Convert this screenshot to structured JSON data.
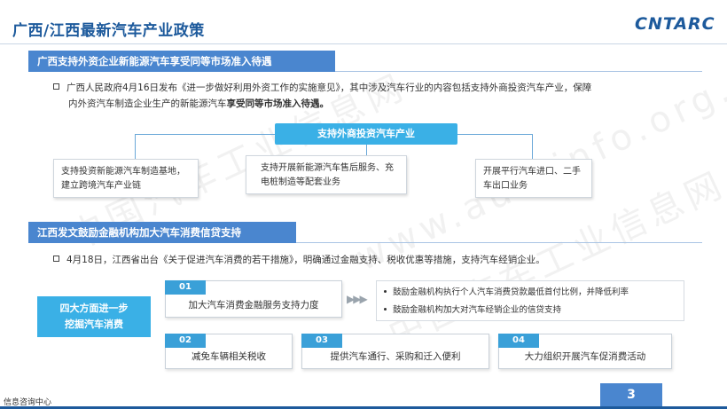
{
  "header": {
    "title": "广西/江西最新汽车产业政策",
    "logo": "CNTARC"
  },
  "section1": {
    "title": "广西支持外资企业新能源汽车享受同等市场准入待遇",
    "bullet_line1": "广西人民政府4月16日发布《进一步做好利用外资工作的实施意见》，其中涉及汽车行业的内容包括支持外商投资汽车产业，保障",
    "bullet_line2_plain": "内外资汽车制造企业生产的新能源汽车",
    "bullet_line2_bold": "享受同等市场准入待遇。",
    "hub": "支持外商投资汽车产业",
    "cards": [
      "支持投资新能源汽车制造基地，建立跨境汽车产业链",
      "支持开展新能源汽车售后服务、充电桩制造等配套业务",
      "开展平行汽车进口、二手车出口业务"
    ]
  },
  "section2": {
    "title": "江西发文鼓励金融机构加大汽车消费信贷支持",
    "bullet": "4月18日，江西省出台《关于促进汽车消费的若干措施》，明确通过金融支持、税收优惠等措施，支持汽车经销企业。",
    "main_box_line1": "四大方面进一步",
    "main_box_line2": "挖掘汽车消费",
    "items": [
      {
        "num": "01",
        "text": "加大汽车消费金融服务支持力度"
      },
      {
        "num": "02",
        "text": "减免车辆相关税收"
      },
      {
        "num": "03",
        "text": "提供汽车通行、采购和迁入便利"
      },
      {
        "num": "04",
        "text": "大力组织开展汽车促消费活动"
      }
    ],
    "effects": [
      "鼓励金融机构执行个人汽车消费贷款最低首付比例，并降低利率",
      "鼓励金融机构加大对汽车经销企业的信贷支持"
    ]
  },
  "footer": {
    "left": "信息咨询中心",
    "page": "3"
  },
  "watermark": {
    "text_cn": "中国汽车工业信息网",
    "text_url": "www.autoinfo.org.cn"
  },
  "colors": {
    "title": "#1d5a9c",
    "section_bar": "#4a86cf",
    "accent": "#3ab0e6"
  }
}
